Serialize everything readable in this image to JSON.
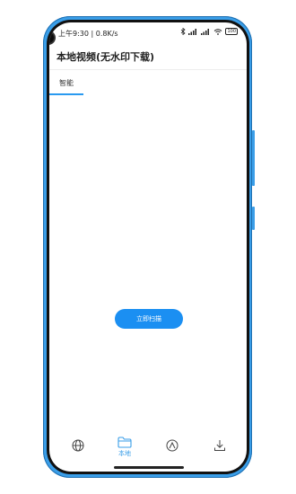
{
  "status_bar": {
    "time_speed": "上午9:30 | 0.8K/s",
    "battery": "100"
  },
  "app_bar": {
    "title": "本地视频(无水印下载)"
  },
  "tabs": [
    {
      "label": "智能",
      "active": true
    }
  ],
  "scan_button": {
    "label": "立即扫描"
  },
  "bottom_nav": [
    {
      "icon": "globe-icon",
      "label": ""
    },
    {
      "icon": "folder-icon",
      "label": "本地",
      "active": true
    },
    {
      "icon": "compass-icon",
      "label": ""
    },
    {
      "icon": "download-icon",
      "label": ""
    }
  ],
  "colors": {
    "accent": "#1b8ff2",
    "phone_frame": "#3a9ee8"
  }
}
